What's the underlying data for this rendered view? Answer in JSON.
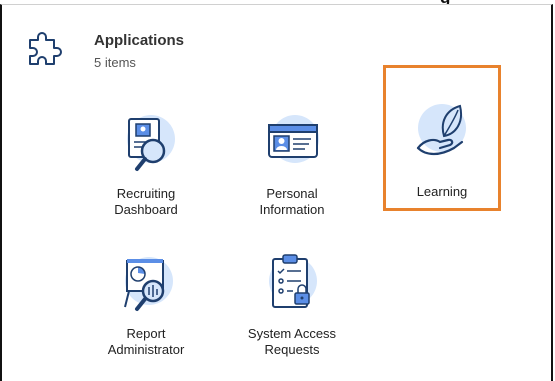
{
  "window": {
    "partial_heading": "g"
  },
  "card": {
    "title": "Applications",
    "count": "5 items"
  },
  "apps": [
    {
      "id": "recruiting-dashboard",
      "line1": "Recruiting",
      "line2": "Dashboard",
      "icon": "recruiting-dashboard-icon"
    },
    {
      "id": "personal-information",
      "line1": "Personal",
      "line2": "Information",
      "icon": "personal-information-icon"
    },
    {
      "id": "learning",
      "line1": "Learning",
      "line2": "",
      "icon": "learning-icon",
      "selected": true
    },
    {
      "id": "report-administrator",
      "line1": "Report",
      "line2": "Administrator",
      "icon": "report-administrator-icon"
    },
    {
      "id": "system-access-requests",
      "line1": "System Access",
      "line2": "Requests",
      "icon": "system-access-requests-icon"
    }
  ],
  "colors": {
    "icon_stroke": "#1f3f6e",
    "icon_fill_light": "#d6e6fb",
    "icon_fill_mid": "#5b8ee6",
    "selection_border": "#e8822d"
  }
}
